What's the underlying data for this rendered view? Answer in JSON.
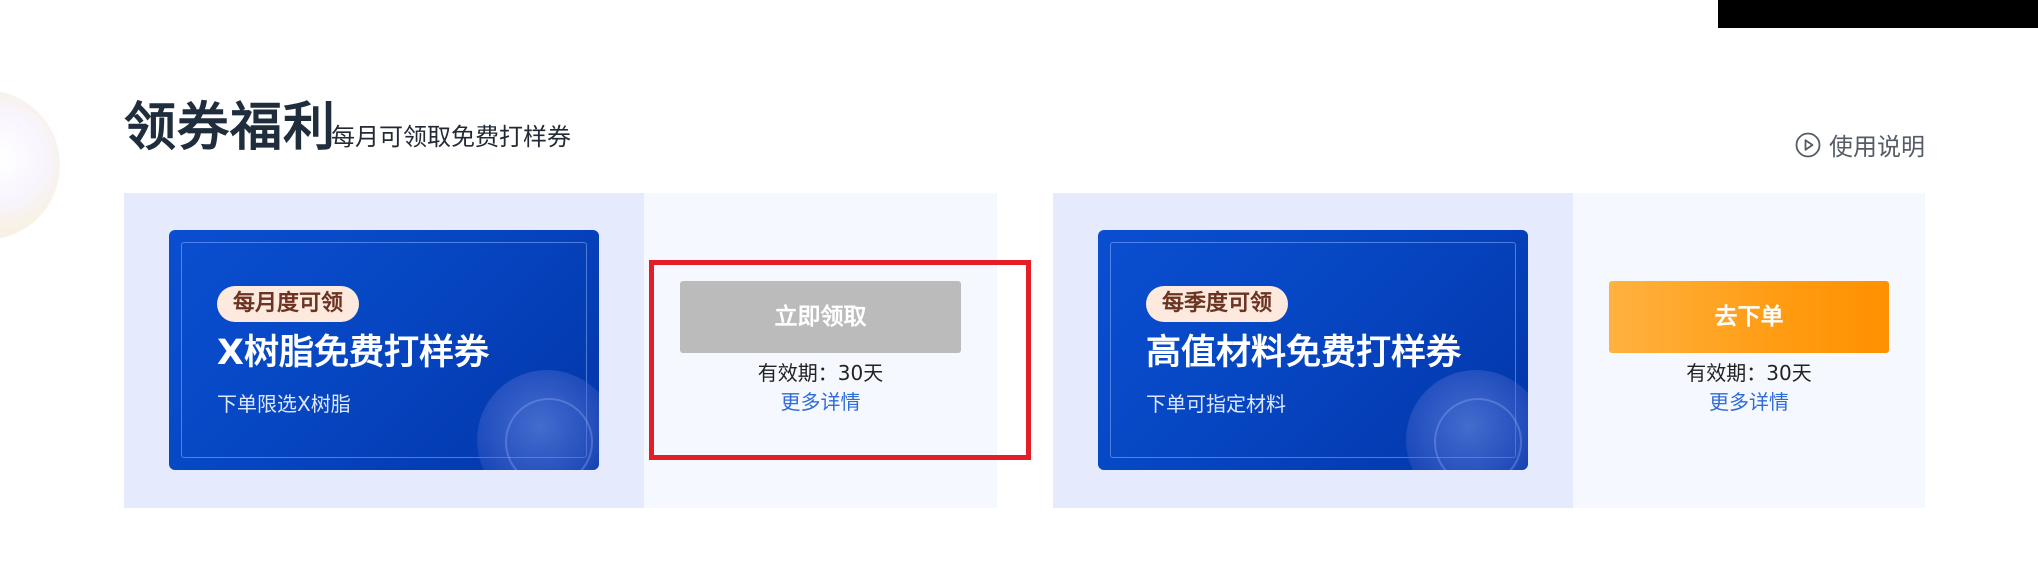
{
  "section": {
    "title": "领券福利",
    "subtitle": "每月可领取免费打样券",
    "help_label": "使用说明"
  },
  "coupons": [
    {
      "badge": "每月度可领",
      "title": "X树脂免费打样券",
      "desc": "下单限选X树脂",
      "action_label": "立即领取",
      "action_state": "disabled",
      "validity": "有效期：30天",
      "more_label": "更多详情"
    },
    {
      "badge": "每季度可领",
      "title": "高值材料免费打样券",
      "desc": "下单可指定材料",
      "action_label": "去下单",
      "action_state": "active",
      "validity": "有效期：30天",
      "more_label": "更多详情"
    }
  ],
  "icons": {
    "help": "play-circle-icon"
  },
  "colors": {
    "accent_blue": "#0646c2",
    "button_disabled": "#bbbbbb",
    "button_orange": "#ff9c13",
    "link_blue": "#2f6bd9",
    "highlight_red": "#e41e26"
  }
}
